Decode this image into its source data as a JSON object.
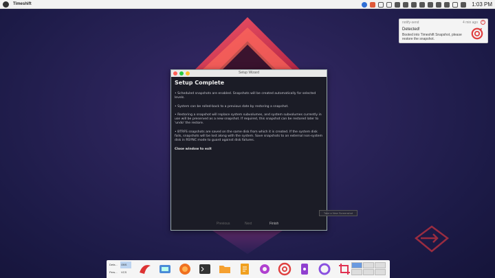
{
  "topbar": {
    "app_title": "Timeshift",
    "clock": "1:03 PM"
  },
  "notification": {
    "app": "notify-send",
    "time": "4 min ago",
    "close_glyph": "×",
    "title": "Detected!",
    "body": "Booted into Timeshift Snapshot, please restore the snapshot."
  },
  "window": {
    "title": "Setup Wizard",
    "heading": "Setup Complete",
    "paragraphs": [
      "• Scheduled snapshots are enabled. Snapshots will be created automatically for selected levels.",
      "• System can be rolled-back to a previous date by restoring a snapshot.",
      "• Restoring a snapshot will replace system subvolumes, and system subvolumes currently in use will be preserved as a new snapshot. If required, this snapshot can be restored later to 'undo' the restore.",
      "• BTRFS snapshots are saved on the same disk from which it is created. If the system disk fails, snapshots will be lost along with the system. Save snapshots to an external non-system disk in RSYNC mode to guard against disk failures."
    ],
    "exit_note": "Close window to exit",
    "buttons": {
      "previous": "Previous",
      "next": "Next",
      "finish": "Finish"
    }
  },
  "tooltip": "Take a New Screenshot",
  "dock": {
    "pager": [
      "Defa...",
      "OBS",
      "Pers...",
      "VCS"
    ]
  },
  "colors": {
    "accent_red": "#e04040",
    "close_red": "#ff5f57",
    "minimize_yellow": "#febc2e",
    "maximize_green": "#28c840"
  }
}
